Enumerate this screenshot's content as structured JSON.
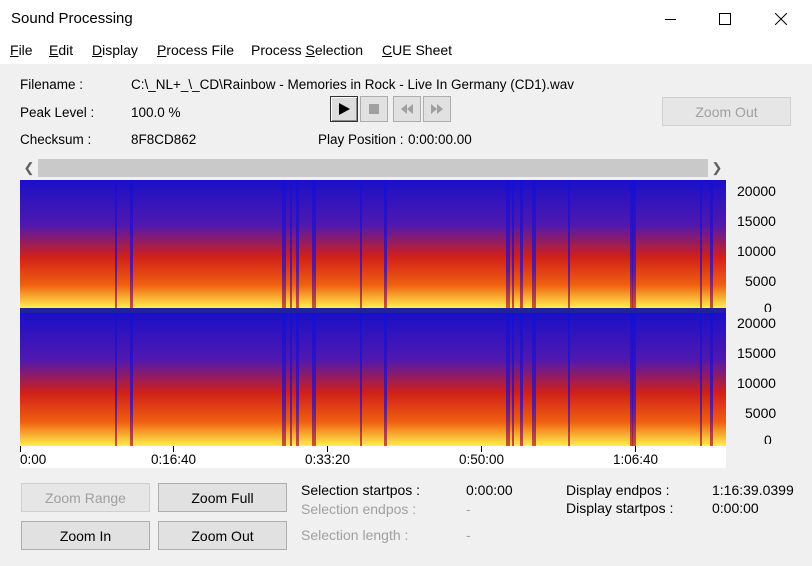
{
  "window": {
    "title": "Sound Processing"
  },
  "menu": {
    "items": [
      {
        "label": "File",
        "u": "F",
        "rest": "ile"
      },
      {
        "label": "Edit",
        "u": "E",
        "rest": "dit"
      },
      {
        "label": "Display",
        "u": "D",
        "rest": "isplay"
      },
      {
        "label": "Process File",
        "pre": "",
        "u": "P",
        "rest": "rocess File"
      },
      {
        "label": "Process Selection",
        "pre": "Process ",
        "u": "S",
        "rest": "election"
      },
      {
        "label": "CUE Sheet",
        "pre": "",
        "u": "C",
        "rest": "UE Sheet"
      }
    ]
  },
  "fileinfo": {
    "filename_label": "Filename :",
    "filename_value": "C:\\_NL+_\\_CD\\Rainbow - Memories in Rock - Live In Germany (CD1).wav",
    "peak_label": "Peak Level :",
    "peak_value": "100.0 %",
    "checksum_label": "Checksum :",
    "checksum_value": "8F8CD862",
    "playpos_label": "Play Position :",
    "playpos_value": "0:00:00.00"
  },
  "transport": {
    "play_icon": "play-icon",
    "stop_icon": "stop-icon",
    "rewind_icon": "rewind-icon",
    "forward_icon": "fast-forward-icon"
  },
  "zoom_out_top": "Zoom Out",
  "spectrogram": {
    "y_ticks": [
      "20000",
      "15000",
      "10000",
      "5000",
      "0"
    ],
    "x_ticks": [
      "0:00",
      "0:16:40",
      "0:33:20",
      "0:50:00",
      "1:06:40"
    ],
    "colors": {
      "low": "#1010d0",
      "mid": "#e01010",
      "high": "#ffff40"
    }
  },
  "buttons": {
    "zoom_range": "Zoom Range",
    "zoom_full": "Zoom Full",
    "zoom_in": "Zoom In",
    "zoom_out": "Zoom Out"
  },
  "selection": {
    "startpos_label": "Selection startpos :",
    "startpos_value": "0:00:00",
    "endpos_label": "Selection endpos :",
    "endpos_value": "-",
    "length_label": "Selection length :",
    "length_value": "-"
  },
  "display": {
    "endpos_label": "Display endpos :",
    "endpos_value": "1:16:39.0399",
    "startpos_label": "Display startpos :",
    "startpos_value": "0:00:00"
  }
}
